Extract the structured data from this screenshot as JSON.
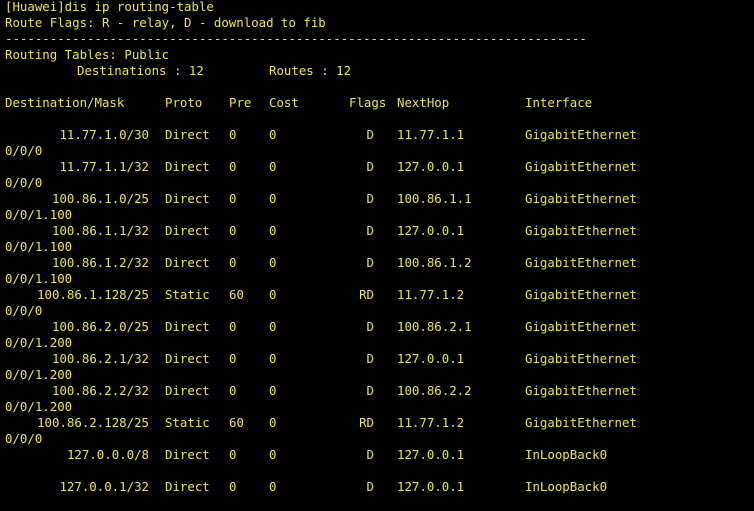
{
  "colors": {
    "background": "#000000",
    "text": "#e8e84a"
  },
  "terminal": {
    "command": "[Huawei]dis ip routing-table",
    "flags_legend": "Route Flags: R - relay, D - download to fib",
    "separator": "------------------------------------------------------------------------------",
    "table_title": "Routing Tables: Public",
    "destinations_label": "Destinations : 12",
    "routes_label": "Routes : 12",
    "columns": {
      "destination": "Destination/Mask",
      "proto": "Proto",
      "pre": "Pre",
      "cost": "Cost",
      "flags": "Flags",
      "nexthop": "NextHop",
      "interface": "Interface"
    },
    "routes": [
      {
        "destination": "11.77.1.0/30",
        "proto": "Direct",
        "pre": "0",
        "cost": "0",
        "flags": "D",
        "nexthop": "11.77.1.1",
        "interface": "GigabitEthernet",
        "interface_cont": "0/0/0"
      },
      {
        "destination": "11.77.1.1/32",
        "proto": "Direct",
        "pre": "0",
        "cost": "0",
        "flags": "D",
        "nexthop": "127.0.0.1",
        "interface": "GigabitEthernet",
        "interface_cont": "0/0/0"
      },
      {
        "destination": "100.86.1.0/25",
        "proto": "Direct",
        "pre": "0",
        "cost": "0",
        "flags": "D",
        "nexthop": "100.86.1.1",
        "interface": "GigabitEthernet",
        "interface_cont": "0/0/1.100"
      },
      {
        "destination": "100.86.1.1/32",
        "proto": "Direct",
        "pre": "0",
        "cost": "0",
        "flags": "D",
        "nexthop": "127.0.0.1",
        "interface": "GigabitEthernet",
        "interface_cont": "0/0/1.100"
      },
      {
        "destination": "100.86.1.2/32",
        "proto": "Direct",
        "pre": "0",
        "cost": "0",
        "flags": "D",
        "nexthop": "100.86.1.2",
        "interface": "GigabitEthernet",
        "interface_cont": "0/0/1.100"
      },
      {
        "destination": "100.86.1.128/25",
        "proto": "Static",
        "pre": "60",
        "cost": "0",
        "flags": "RD",
        "nexthop": "11.77.1.2",
        "interface": "GigabitEthernet",
        "interface_cont": "0/0/0"
      },
      {
        "destination": "100.86.2.0/25",
        "proto": "Direct",
        "pre": "0",
        "cost": "0",
        "flags": "D",
        "nexthop": "100.86.2.1",
        "interface": "GigabitEthernet",
        "interface_cont": "0/0/1.200"
      },
      {
        "destination": "100.86.2.1/32",
        "proto": "Direct",
        "pre": "0",
        "cost": "0",
        "flags": "D",
        "nexthop": "127.0.0.1",
        "interface": "GigabitEthernet",
        "interface_cont": "0/0/1.200"
      },
      {
        "destination": "100.86.2.2/32",
        "proto": "Direct",
        "pre": "0",
        "cost": "0",
        "flags": "D",
        "nexthop": "100.86.2.2",
        "interface": "GigabitEthernet",
        "interface_cont": "0/0/1.200"
      },
      {
        "destination": "100.86.2.128/25",
        "proto": "Static",
        "pre": "60",
        "cost": "0",
        "flags": "RD",
        "nexthop": "11.77.1.2",
        "interface": "GigabitEthernet",
        "interface_cont": "0/0/0"
      },
      {
        "destination": "127.0.0.0/8",
        "proto": "Direct",
        "pre": "0",
        "cost": "0",
        "flags": "D",
        "nexthop": "127.0.0.1",
        "interface": "InLoopBack0",
        "interface_cont": ""
      },
      {
        "destination": "127.0.0.1/32",
        "proto": "Direct",
        "pre": "0",
        "cost": "0",
        "flags": "D",
        "nexthop": "127.0.0.1",
        "interface": "InLoopBack0",
        "interface_cont": ""
      }
    ]
  }
}
